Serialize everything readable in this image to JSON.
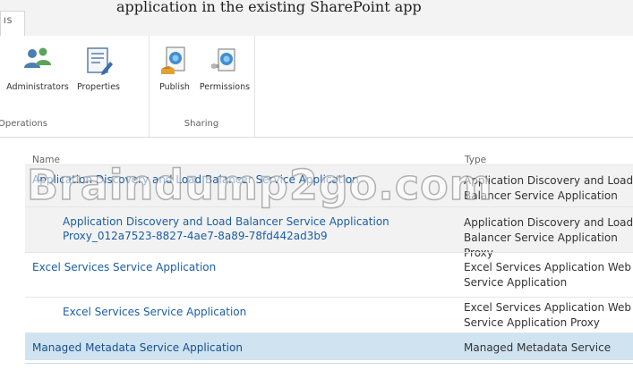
{
  "header": {
    "top_text": "application in the existing SharePoint app",
    "tab_label": "IS"
  },
  "ribbon": {
    "groups": [
      {
        "label": "Operations",
        "buttons": [
          {
            "label": "Administrators",
            "icon": "administrators-icon"
          },
          {
            "label": "Properties",
            "icon": "properties-icon"
          }
        ]
      },
      {
        "label": "Sharing",
        "buttons": [
          {
            "label": "Publish",
            "icon": "publish-icon"
          },
          {
            "label": "Permissions",
            "icon": "permissions-icon"
          }
        ]
      }
    ]
  },
  "list": {
    "columns": {
      "name": "Name",
      "type": "Type"
    },
    "rows": [
      {
        "name": "Application Discovery and Load Balancer Service Application",
        "type": "Application Discovery and Load Balancer Service Application"
      },
      {
        "name": "Application Discovery and Load Balancer Service Application Proxy_012a7523-8827-4ae7-8a89-78fd442ad3b9",
        "type": "Application Discovery and Load Balancer Service Application Proxy"
      },
      {
        "name": "Excel Services Service Application",
        "type": "Excel Services Application Web Service Application"
      },
      {
        "name": "Excel Services Service Application",
        "type": "Excel Services Application Web Service Application Proxy"
      },
      {
        "name": "Managed Metadata Service Application",
        "type": "Managed Metadata Service"
      }
    ],
    "selected_row": 4
  },
  "watermark": "Braindump2go.com",
  "colors": {
    "link": "#1b5ea8",
    "selected_row": "#cfe3f1",
    "shaded_row": "#f2f2f2"
  }
}
